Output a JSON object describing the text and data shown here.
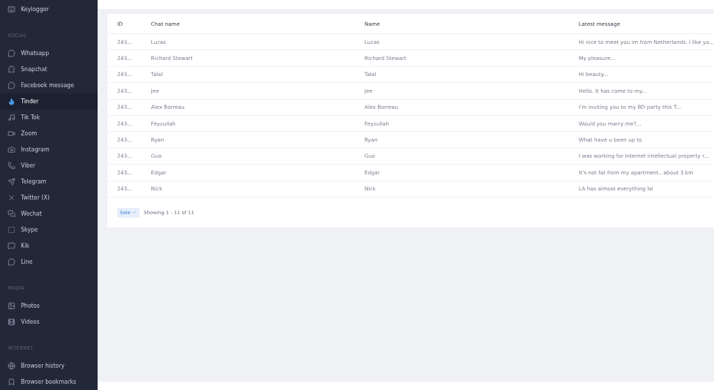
{
  "sidebar": {
    "sections": [
      {
        "items": [
          {
            "label": "Keylogger",
            "selected": false
          }
        ]
      },
      {
        "heading": "SOCIAL",
        "items": [
          {
            "label": "Whatsapp",
            "selected": false
          },
          {
            "label": "Snapchat",
            "selected": false
          },
          {
            "label": "Facebook message",
            "selected": false
          },
          {
            "label": "Tinder",
            "selected": true
          },
          {
            "label": "Tik Tok",
            "selected": false
          },
          {
            "label": "Zoom",
            "selected": false
          },
          {
            "label": "Instagram",
            "selected": false
          },
          {
            "label": "Viber",
            "selected": false
          },
          {
            "label": "Telegram",
            "selected": false
          },
          {
            "label": "Twitter (X)",
            "selected": false
          },
          {
            "label": "Wechat",
            "selected": false
          },
          {
            "label": "Skype",
            "selected": false
          },
          {
            "label": "Kik",
            "selected": false
          },
          {
            "label": "Line",
            "selected": false
          }
        ]
      },
      {
        "heading": "MEDIA",
        "items": [
          {
            "label": "Photos",
            "selected": false
          },
          {
            "label": "Videos",
            "selected": false
          }
        ]
      },
      {
        "heading": "INTERNET",
        "items": [
          {
            "label": "Browser history",
            "selected": false
          },
          {
            "label": "Browser bookmarks",
            "selected": false
          }
        ]
      }
    ]
  },
  "table": {
    "columns": [
      "ID",
      "Chat name",
      "Name",
      "Latest message"
    ],
    "rows": [
      [
        "243...",
        "Lucas",
        "Lucas",
        "Hi nice to meet you im from Netherlands. I like yo..."
      ],
      [
        "243...",
        "Richard Stewart",
        "Richard Stewart",
        "My pleasure..."
      ],
      [
        "243...",
        "Talal",
        "Talal",
        "Hi beauty..."
      ],
      [
        "243...",
        "Jee",
        "Jee",
        "Hello. It has come to my..."
      ],
      [
        "243...",
        "Alex Borreau",
        "Alex Borreau",
        "I'm inviting you to my BD party this T..."
      ],
      [
        "243...",
        "Feyzullah",
        "Feyzullah",
        "Would you marry me?..."
      ],
      [
        "243...",
        "Ryan",
        "Ryan",
        "What have u been up to"
      ],
      [
        "243...",
        "Guo",
        "Guo",
        "I was working for Internet intellectual property r..."
      ],
      [
        "243...",
        "Edgar",
        "Edgar",
        "It's not fat from my apartment.. about 3 km"
      ],
      [
        "243...",
        "Nick",
        "Nick",
        "LA has almost everything lol"
      ]
    ]
  },
  "pagination": {
    "page_size_select": "Sele",
    "summary": "Showing 1 - 11 of 11"
  }
}
